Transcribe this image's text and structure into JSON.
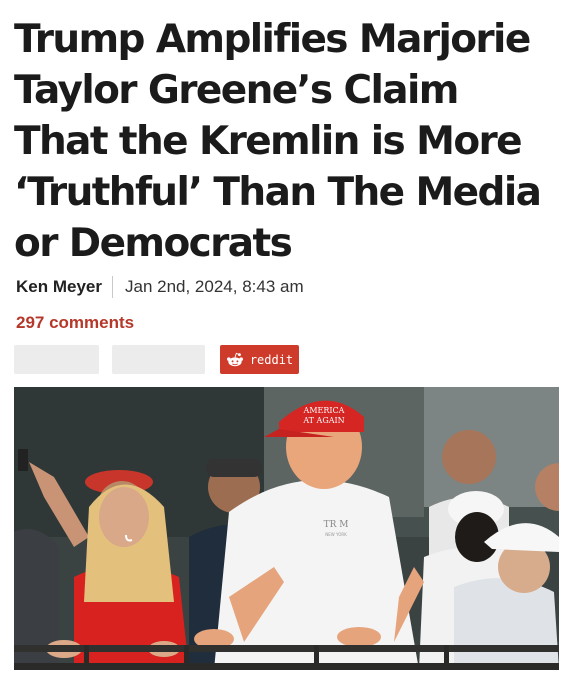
{
  "article": {
    "headline": "Trump Amplifies Marjorie Taylor Greene’s Claim That the Kremlin is More ‘Truthful’ Than The Media or Democrats",
    "author": "Ken Meyer",
    "date": "Jan 2nd, 2024, 8:43 am",
    "comments_link": "297 comments"
  },
  "share": {
    "reddit_label": "reddit"
  },
  "photo": {
    "hat_text_line1": "AMERICA",
    "hat_text_line2": "AT AGAIN",
    "shirt_logo": "TR M",
    "shirt_logo_sub": "NEW YORK"
  },
  "colors": {
    "accent": "#b5382a",
    "reddit_button": "#cf3b2a"
  }
}
